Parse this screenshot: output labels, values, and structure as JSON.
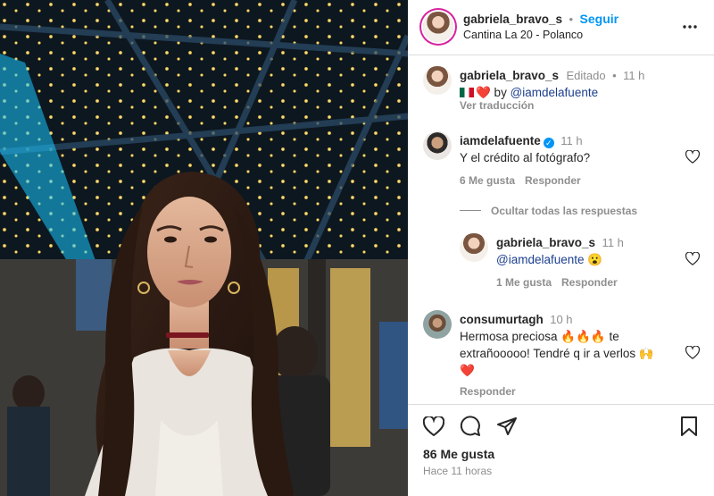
{
  "header": {
    "username": "gabriela_bravo_s",
    "separator": "•",
    "follow_label": "Seguir",
    "location": "Cantina La 20 - Polanco",
    "more_icon": "more-horizontal-icon"
  },
  "caption": {
    "username": "gabriela_bravo_s",
    "edited": "Editado",
    "separator": "•",
    "time": "11 h",
    "text_prefix": "❤️ by ",
    "mention": "@iamdelafuente",
    "translate": "Ver traducción"
  },
  "comments": [
    {
      "username": "iamdelafuente",
      "time": "11 h",
      "text": "Y el crédito al fotógrafo?",
      "likes": "6 Me gusta",
      "reply_label": "Responder",
      "hide_replies": "Ocultar todas las respuestas",
      "replies": [
        {
          "username": "gabriela_bravo_s",
          "time": "11 h",
          "mention": "@iamdelafuente",
          "emoji": "😮",
          "likes": "1 Me gusta",
          "reply_label": "Responder"
        }
      ]
    },
    {
      "username": "consumurtagh",
      "time": "10 h",
      "text_line1": "Hermosa preciosa 🔥🔥🔥 te",
      "text_line2": "extrañooooo! Tendré q ir a verlos 🙌",
      "text_line3": "❤️",
      "reply_label": "Responder"
    }
  ],
  "footer": {
    "likes": "86 Me gusta",
    "posted": "Hace 11 horas",
    "icons": [
      "heart-icon",
      "comment-icon",
      "share-icon",
      "bookmark-icon"
    ]
  },
  "colors": {
    "accent_blue": "#0095f6",
    "mention_blue": "#1b3f8f",
    "muted": "#8e8e8e",
    "border": "#dbdbdb"
  }
}
